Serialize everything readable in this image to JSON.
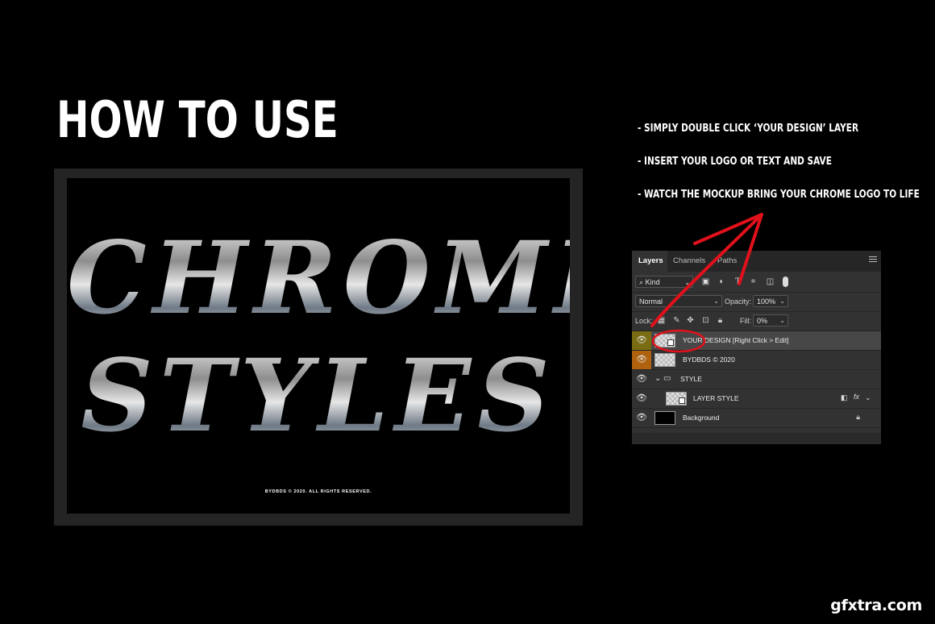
{
  "headline": "HOW TO USE",
  "instructions": [
    "- SIMPLY DOUBLE CLICK ‘YOUR DESIGN’ LAYER",
    "- INSERT YOUR LOGO OR TEXT AND SAVE",
    "- WATCH THE MOCKUP BRING YOUR CHROME LOGO TO LIFE"
  ],
  "poster": {
    "line1": "CHROME",
    "line2": "STYLES",
    "footer": "BYDBDS © 2020. ALL RIGHTS RESERVED."
  },
  "layers_panel": {
    "tabs": [
      "Layers",
      "Channels",
      "Paths"
    ],
    "filter_kind": "Kind",
    "blend_mode": "Normal",
    "opacity_label": "Opacity:",
    "opacity_value": "100%",
    "lock_label": "Lock:",
    "fill_label": "Fill:",
    "fill_value": "0%",
    "layers": [
      {
        "name": "YOUR DESIGN [Right Click > Edit]"
      },
      {
        "name": "BYDBDS © 2020"
      },
      {
        "name": "STYLE"
      },
      {
        "name": "LAYER STYLE"
      },
      {
        "name": "Background"
      }
    ]
  },
  "watermark": "gfxtra.com",
  "colors": {
    "accent_red": "#e1111b",
    "panel_bg": "#323232",
    "eye_orange": "#b0620e"
  }
}
